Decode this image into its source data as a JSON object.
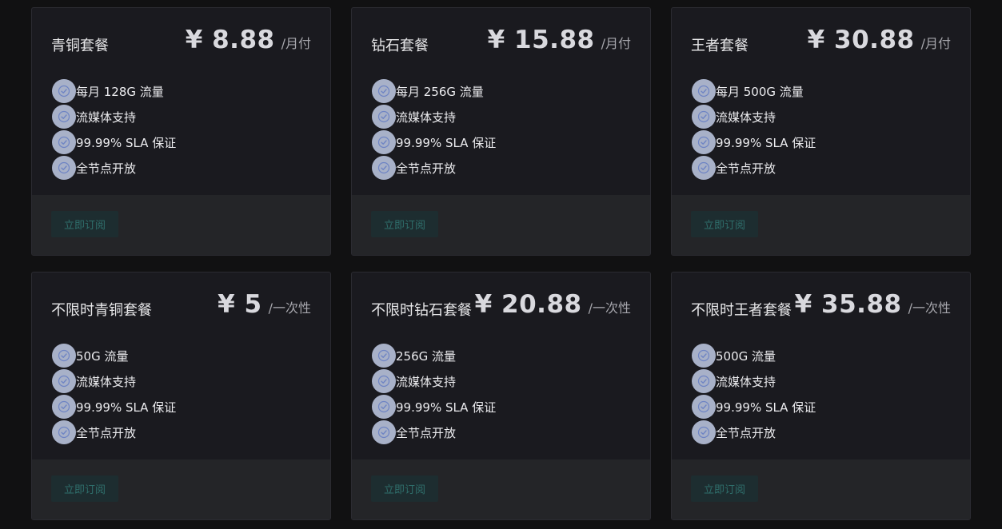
{
  "plans": [
    {
      "name": "青铜套餐",
      "price": "¥ 8.88",
      "period": "/月付",
      "features": [
        "每月 128G 流量",
        "流媒体支持",
        "99.99% SLA 保证",
        "全节点开放"
      ],
      "button": "立即订阅"
    },
    {
      "name": "钻石套餐",
      "price": "¥ 15.88",
      "period": "/月付",
      "features": [
        "每月 256G 流量",
        "流媒体支持",
        "99.99% SLA 保证",
        "全节点开放"
      ],
      "button": "立即订阅"
    },
    {
      "name": "王者套餐",
      "price": "¥ 30.88",
      "period": "/月付",
      "features": [
        "每月 500G 流量",
        "流媒体支持",
        "99.99% SLA 保证",
        "全节点开放"
      ],
      "button": "立即订阅"
    },
    {
      "name": "不限时青铜套餐",
      "price": "¥ 5",
      "period": "/一次性",
      "features": [
        "50G 流量",
        "流媒体支持",
        "99.99% SLA 保证",
        "全节点开放"
      ],
      "button": "立即订阅"
    },
    {
      "name": "不限时钻石套餐",
      "price": "¥ 20.88",
      "period": "/一次性",
      "features": [
        "256G 流量",
        "流媒体支持",
        "99.99% SLA 保证",
        "全节点开放"
      ],
      "button": "立即订阅"
    },
    {
      "name": "不限时王者套餐",
      "price": "¥ 35.88",
      "period": "/一次性",
      "features": [
        "500G 流量",
        "流媒体支持",
        "99.99% SLA 保证",
        "全节点开放"
      ],
      "button": "立即订阅"
    }
  ],
  "icons": {
    "feature": "check-circle-icon"
  },
  "colors": {
    "page_background": "#111112",
    "card_background": "#1a1a1f",
    "card_footer": "#242528",
    "check_circle": "#a8b1c8",
    "check_mark": "#6e84c4",
    "button_background": "#1d2d30",
    "button_text": "#2f6f6c"
  }
}
